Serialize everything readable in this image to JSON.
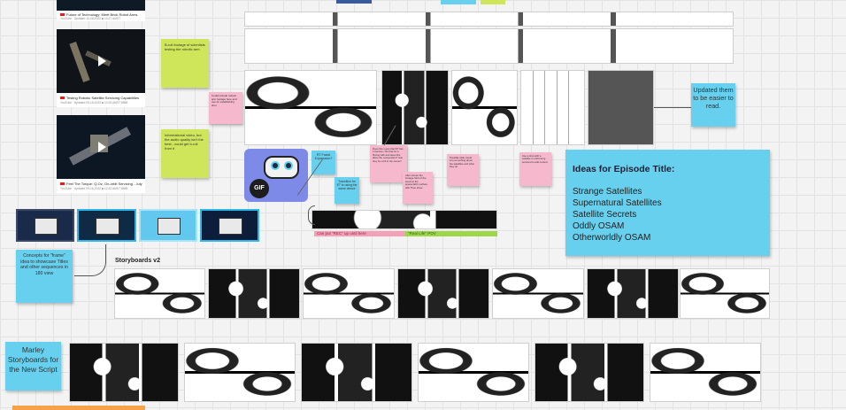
{
  "videos": [
    {
      "title": "Future of Technology: Meet Brick Robot Arms",
      "meta": "YouTube · Updated 10-08-2022 ■ 14:27 AMST"
    },
    {
      "title": "Testing Robotic Satellite Servicing Capabilities",
      "meta": "YouTube · Updated 09-16-2022 ■ 10:29 AMST 8888"
    },
    {
      "title": "Feel The Torque: Q-Oz, On-orbit Servicing - July",
      "meta": "YouTube · Updated 09-16-2022 ■ 12:32 AMST 8888"
    }
  ],
  "stickies": {
    "broll": "B-roll footage of scientists testing the robotic arm",
    "informational": "Informational video, but the audio quality isn't the best - could get b-roll from it",
    "pink1": "Could include robotic arm footage here and use for establishing shot",
    "updated": "Updated them to be easier to read.",
    "rt_facial": "RT Facial Expression?",
    "transition": "Transition for ET to using the same device",
    "pink_center": "Does this mean that RT has it Venture / fits that for a filming with and does this allow the composition? Can they be a bit in the scene?",
    "pink_lower": "After screen the footage hard of the stand at the spacecraft's surface, with Theo show",
    "pink_right1": "Possible slide visual into something about the satellites and what they do",
    "pink_right2": "Use a shot with a satellite in orbit being serviced to add context",
    "concepts": "Concepts for \"frame\" idea to showcase Titles and other sequences in 180 view",
    "marley": "Marley Storyboards for the New Script"
  },
  "gif_label": "GIF",
  "ideas": {
    "title": "Ideas for Episode Title:",
    "items": [
      "Strange Satellites",
      "Supernatural Satellites",
      "Satellite Secrets",
      "Oddly OSAM",
      "Otherworldly OSAM"
    ]
  },
  "bars": {
    "rec": "Can put \"REC\" up until here",
    "real": "\"Real Life\" POV"
  },
  "section_titles": {
    "storyboards_v2": "Storyboards v2"
  },
  "colors": {
    "yellow_sticky": "#cfe65a",
    "pink_sticky": "#f6b8cc",
    "blue_sticky": "#67d0ee",
    "canvas": "#f3f3f3"
  }
}
